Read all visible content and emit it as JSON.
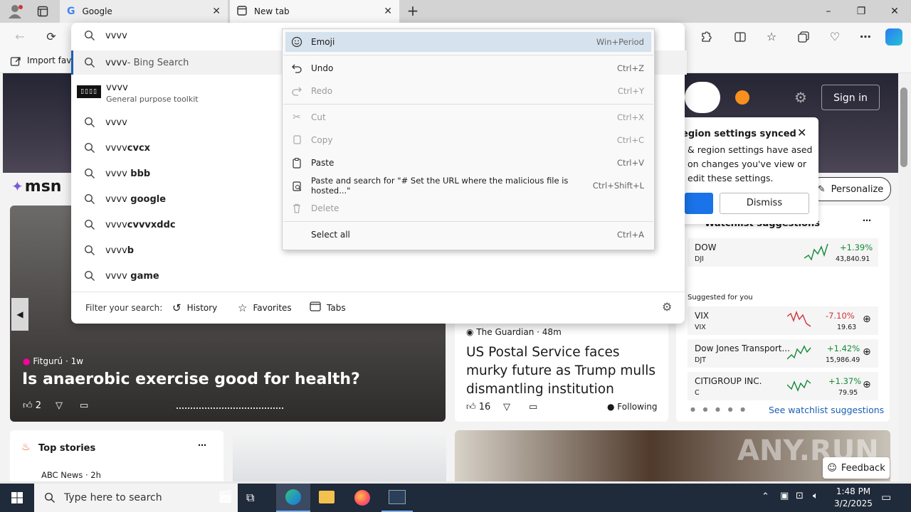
{
  "tabs": [
    {
      "title": "Google",
      "state": "inactive"
    },
    {
      "title": "New tab",
      "state": "active"
    }
  ],
  "window_controls": {
    "minimize": "–",
    "maximize": "❐",
    "close": "✕"
  },
  "address": {
    "value": "vvvv"
  },
  "favorites_bar": {
    "import_label": "Import favo"
  },
  "suggestions": {
    "bing_item": {
      "query": "vvvv",
      "suffix": " - Bing Search"
    },
    "site_item": {
      "title": "vvvv",
      "subtitle": "General purpose toolkit"
    },
    "items": [
      {
        "prefix": "vvvv",
        "bold": ""
      },
      {
        "prefix": "vvvv",
        "bold": "cvcx"
      },
      {
        "prefix": "vvvv",
        "bold": " bbb"
      },
      {
        "prefix": "vvvv",
        "bold": " google"
      },
      {
        "prefix": "vvvv",
        "bold": "cvvvxddc"
      },
      {
        "prefix": "vvvv",
        "bold": "b"
      },
      {
        "prefix": "vvvv",
        "bold": " game"
      }
    ],
    "filter": {
      "label": "Filter your search:",
      "history": "History",
      "favorites": "Favorites",
      "tabs": "Tabs"
    }
  },
  "context_menu": [
    {
      "label": "Emoji",
      "shortcut": "Win+Period",
      "disabled": false,
      "highlight": true,
      "icon": "emoji-icon"
    },
    {
      "label": "Undo",
      "shortcut": "Ctrl+Z",
      "disabled": false,
      "icon": "undo-icon"
    },
    {
      "label": "Redo",
      "shortcut": "Ctrl+Y",
      "disabled": true,
      "icon": "redo-icon"
    },
    {
      "label": "Cut",
      "shortcut": "Ctrl+X",
      "disabled": true,
      "icon": "cut-icon"
    },
    {
      "label": "Copy",
      "shortcut": "Ctrl+C",
      "disabled": true,
      "icon": "copy-icon"
    },
    {
      "label": "Paste",
      "shortcut": "Ctrl+V",
      "disabled": false,
      "icon": "paste-icon"
    },
    {
      "label": "Paste and search for \"# Set the URL where the malicious file is hosted...\"",
      "shortcut": "Ctrl+Shift+L",
      "disabled": false,
      "icon": "paste-search-icon"
    },
    {
      "label": "Delete",
      "shortcut": "",
      "disabled": true,
      "icon": "delete-icon"
    },
    {
      "label": "Select all",
      "shortcut": "Ctrl+A",
      "disabled": false,
      "icon": ""
    }
  ],
  "msn": {
    "logo_text": "msn",
    "sign_in": "Sign in",
    "personalize": "Personalize",
    "notice": {
      "title": "egion settings synced",
      "body": "& region settings have ased on changes you've view or edit these settings.",
      "dismiss": "Dismiss"
    },
    "hero_article": {
      "source": "Fitgurú",
      "age": "1w",
      "title": "Is anaerobic exercise good for health?",
      "likes": "2"
    },
    "guardian_article": {
      "source": "The Guardian",
      "age": "48m",
      "title": "US Postal Service faces murky future as Trump mulls dismantling institution",
      "likes": "16",
      "following": "Following"
    },
    "top_stories": {
      "title": "Top stories",
      "first_source": "ABC News · 2h"
    },
    "watchlist": {
      "title": "Watchlist suggestions",
      "suggested_label": "Suggested for you",
      "see_more": "See watchlist suggestions",
      "stocks": [
        {
          "name": "DOW",
          "ticker": "DJI",
          "change": "+1.39%",
          "price": "43,840.91",
          "up": true
        },
        {
          "name": "VIX",
          "ticker": "VIX",
          "change": "-7.10%",
          "price": "19.63",
          "up": false
        },
        {
          "name": "Dow Jones Transport...",
          "ticker": "DJT",
          "change": "+1.42%",
          "price": "15,986.49",
          "up": true
        },
        {
          "name": "CITIGROUP INC.",
          "ticker": "C",
          "change": "+1.37%",
          "price": "79.95",
          "up": true
        }
      ]
    },
    "feedback": "Feedback",
    "watermark": "ANY.RUN"
  },
  "taskbar": {
    "search_placeholder": "Type here to search",
    "time": "1:48 PM",
    "date": "3/2/2025"
  },
  "colors": {
    "accent_blue": "#1a73e8",
    "up_green": "#138a36",
    "down_red": "#d13438",
    "highlight": "#d6e2ee"
  }
}
